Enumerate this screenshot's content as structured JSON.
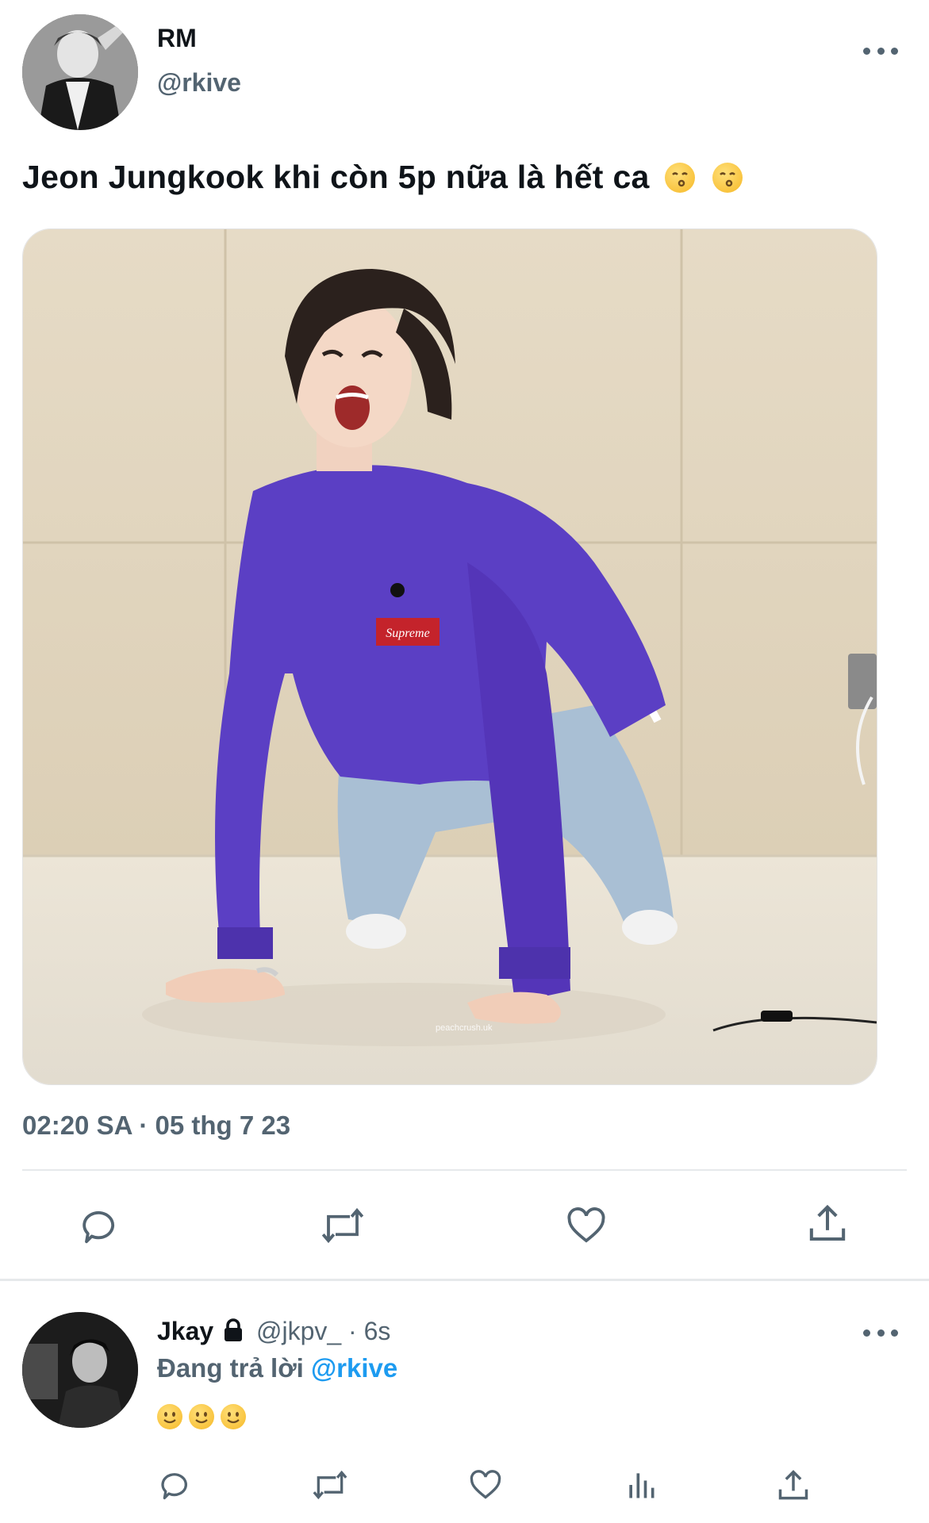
{
  "tweet": {
    "author_name": "RM",
    "author_handle": "@rkive",
    "text": "Jeon Jungkook khi còn 5p nữa là hết ca",
    "emojis": [
      "kissing-face-emoji",
      "kissing-face-emoji"
    ],
    "timestamp": "02:20 SA · 05 thg 7 23",
    "image_watermark": "peachcrush.uk",
    "sweater_logo": "Supreme",
    "actions": [
      "reply-icon",
      "retweet-icon",
      "like-icon",
      "share-icon"
    ]
  },
  "reply": {
    "author_name": "Jkay",
    "author_handle": "@jkpv_",
    "time": "· 6s",
    "replying_prefix": "Đang trả lời",
    "replying_to": "@rkive",
    "emojis": [
      "slightly-smiling-face-emoji",
      "slightly-smiling-face-emoji",
      "slightly-smiling-face-emoji"
    ],
    "actions": [
      "reply-icon",
      "retweet-icon",
      "like-icon",
      "analytics-icon",
      "share-icon"
    ]
  },
  "colors": {
    "text": "#0f1419",
    "secondary": "#536471",
    "link": "#1d9bf0",
    "sweater": "#5b3fc4",
    "wall": "#e8dcc4"
  }
}
